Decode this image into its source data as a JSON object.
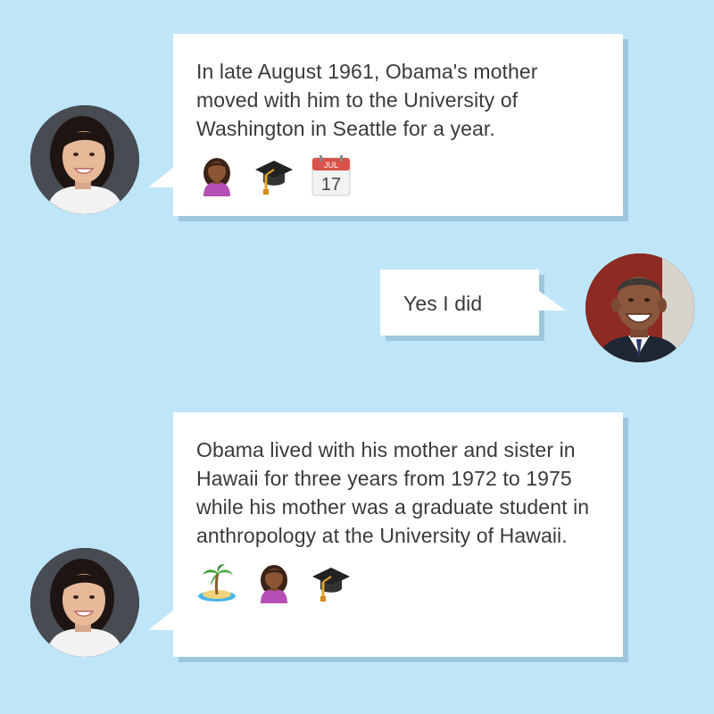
{
  "messages": [
    {
      "sender": "woman",
      "text": "In late August 1961, Obama's mother moved with him to the University of Washington in Seattle for a year.",
      "emoji_icons": [
        "woman-icon",
        "graduation-cap-icon",
        "calendar-icon"
      ],
      "calendar": {
        "month": "JUL",
        "day": "17"
      }
    },
    {
      "sender": "obama",
      "text": "Yes I did"
    },
    {
      "sender": "woman",
      "text": "Obama lived with his mother and sister in Hawaii for three years from 1972 to 1975 while his mother was a graduate student in anthropology at the University of Hawaii.",
      "emoji_icons": [
        "island-icon",
        "woman-icon",
        "graduation-cap-icon"
      ]
    }
  ],
  "colors": {
    "background": "#bfe5f8",
    "bubble": "#ffffff",
    "bubble_shadow": "#9ec6dc",
    "text": "#3a3a3a"
  }
}
